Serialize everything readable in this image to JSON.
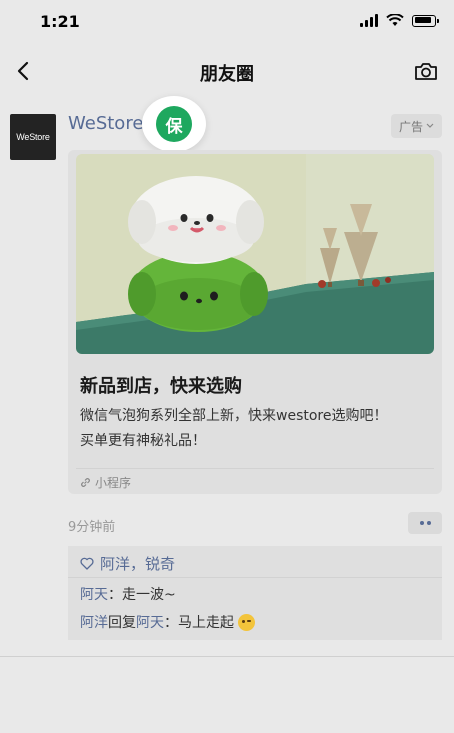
{
  "status_bar": {
    "time": "1:21"
  },
  "nav": {
    "title": "朋友圈"
  },
  "post": {
    "avatar_text": "WeStore",
    "author": "WeStore",
    "badge_label": "保",
    "ad_label": "广告",
    "ad": {
      "title": "新品到店，快来选购",
      "description_lines": [
        "微信气泡狗系列全部上新，快来westore选购吧！",
        "买单更有神秘礼品！"
      ],
      "source": "小程序"
    },
    "time_ago": "9分钟前",
    "likes": "阿洋，锐奇",
    "comments": [
      {
        "author": "阿天",
        "separator": "：",
        "text": "走一波~"
      },
      {
        "author": "阿洋",
        "reply_word": "回复",
        "reply_to": "阿天",
        "separator": "：",
        "text": "马上走起"
      }
    ]
  },
  "icons": [
    "back-icon",
    "camera-icon",
    "chevron-down-icon",
    "link-icon",
    "heart-icon",
    "smile-emoji-icon",
    "more-dots-icon"
  ],
  "colors": {
    "link_blue": "#576b95",
    "badge_green": "#1ea85f",
    "background": "#e9e9e9"
  }
}
